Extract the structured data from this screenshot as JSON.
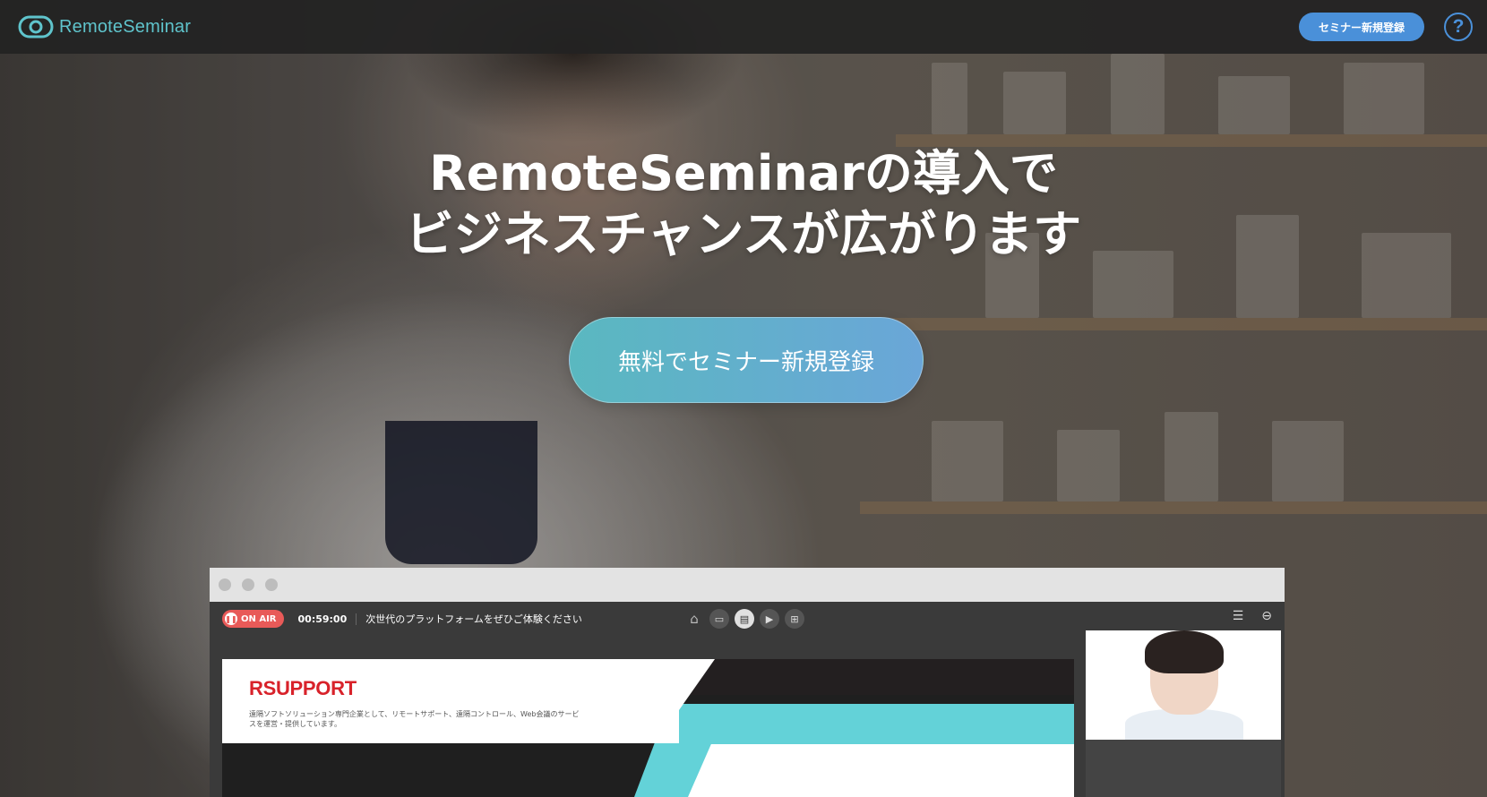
{
  "navbar": {
    "brand_name": "RemoteSeminar",
    "register_button": "セミナー新規登録",
    "help_icon": "?"
  },
  "hero": {
    "headline_line1": "RemoteSeminarの導入で",
    "headline_line2": "ビジネスチャンスが広がります",
    "cta_label": "無料でセミナー新規登録"
  },
  "app_preview": {
    "onair_label": "ON AIR",
    "timer": "00:59:00",
    "session_title": "次世代のプラットフォームをぜひご体験ください",
    "toolbar_icons": [
      "home-icon",
      "screen-icon",
      "document-icon",
      "video-icon",
      "grid-icon"
    ],
    "right_icons": [
      "menu-icon",
      "exit-icon"
    ],
    "slide": {
      "brand": "RSUPPORT",
      "description": "遠隔ソフトソリューション専門企業として、リモートサポート、遠隔コントロール、Web会議のサービスを運営・提供しています。"
    }
  },
  "colors": {
    "brand_teal": "#5fc4cc",
    "nav_button": "#4a90d9",
    "cta_gradient_start": "#5ab8c0",
    "cta_gradient_end": "#6aa6d8",
    "onair_red": "#e85a58",
    "slide_cyan": "#63d2d8"
  }
}
